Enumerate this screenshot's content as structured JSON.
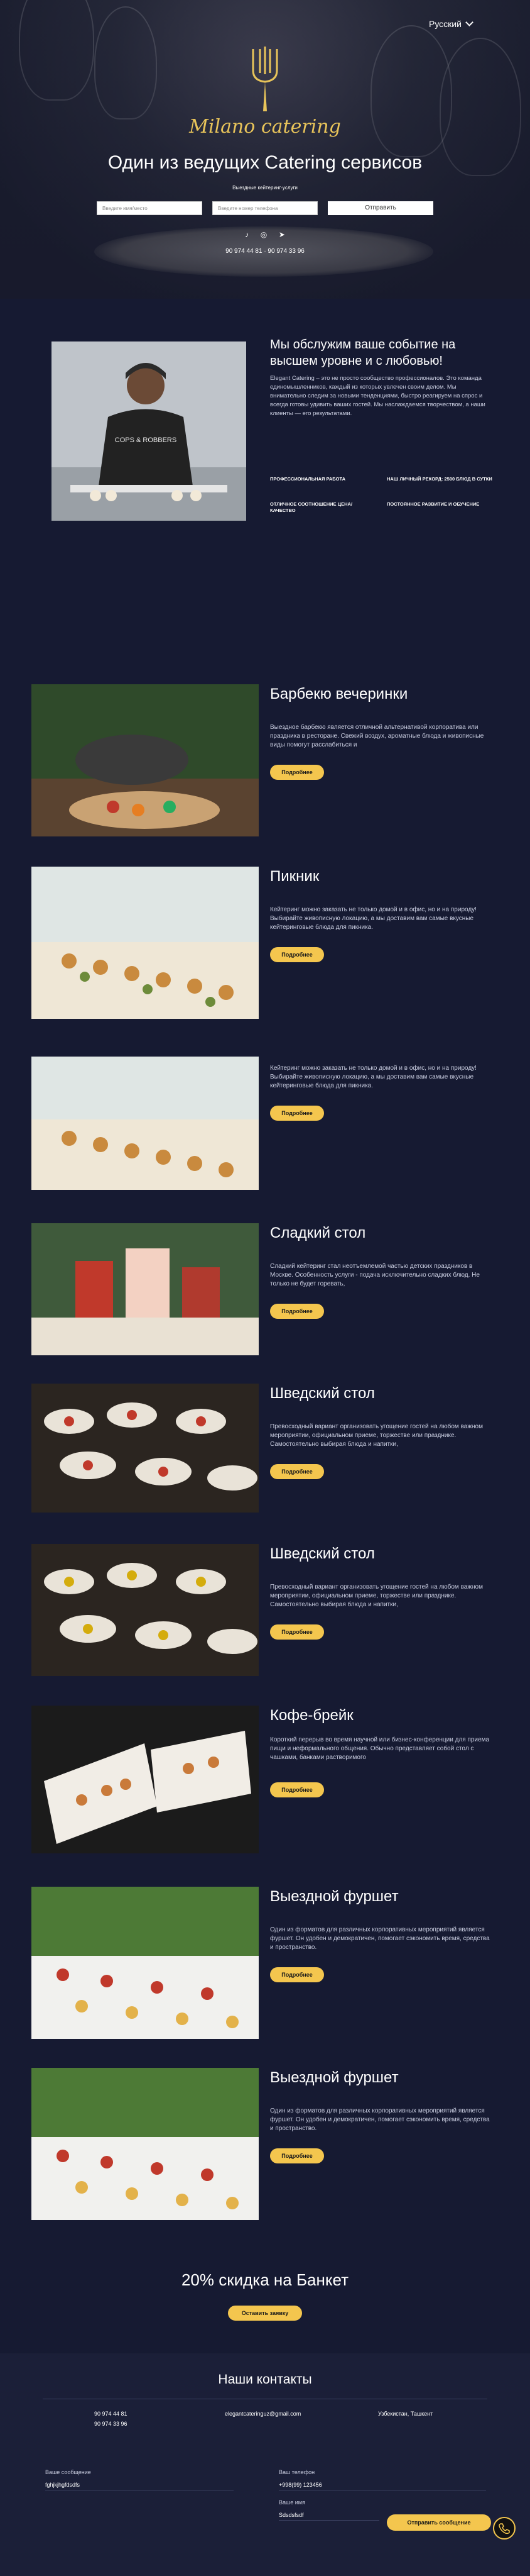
{
  "header": {
    "language": "Русский",
    "brand": "Milano catering",
    "headline": "Один из ведущих Catering сервисов",
    "subline": "Выездные кейтеринг-услуги",
    "fields": [
      "Введите имя/место",
      "Введите номер телефона",
      ""
    ],
    "send_label": "Отправить",
    "phones": "90 974 44 81  ·  90 974 33 96"
  },
  "about": {
    "title": "Мы обслужим ваше событие на высшем уровне и с любовью!",
    "text": "Elegant Catering – это не просто сообщество профессионалов. Это команда единомышленников, каждый из которых увлечен своим делом. Мы внимательно следим за новыми тенденциями, быстро реагируем на спрос и всегда готовы удивить ваших гостей. Мы наслаждаемся творчеством, а наши клиенты — его результатами.",
    "features": [
      "ПРОФЕССИОНАЛЬНАЯ РАБОТА",
      "НАШ ЛИЧНЫЙ РЕКОРД: 2500 БЛЮД В СУТКИ",
      "ОТЛИЧНОЕ СООТНОШЕНИЕ ЦЕНА/КАЧЕСТВО",
      "ПОСТОЯННОЕ РАЗВИТИЕ И ОБУЧЕНИЕ"
    ]
  },
  "services": [
    {
      "title": "Барбекю вечеринки",
      "desc": "Выездное барбекю является отличной альтернативой корпоратива или праздника в ресторане. Свежий воздух, ароматные блюда и живописные виды помогут расслабиться и",
      "button": "Подробнее"
    },
    {
      "title": "Пикник",
      "desc": "Кейтеринг можно заказать не только домой и в офис, но и на природу! Выбирайте живописную локацию, а мы доставим вам самые вкусные кейтеринговые блюда для пикника.",
      "button": "Подробнее"
    },
    {
      "title": "",
      "desc": "Кейтеринг можно заказать не только домой и в офис, но и на природу! Выбирайте живописную локацию, а мы доставим вам самые вкусные кейтеринговые блюда для пикника.",
      "button": "Подробнее"
    },
    {
      "title": "Сладкий стол",
      "desc": "Сладкий кейтеринг стал неотъемлемой частью детских праздников в Москве. Особенность услуги - подача исключительно сладких блюд. Не только не будет горевать,",
      "button": "Подробнее"
    },
    {
      "title": "Шведский стол",
      "desc": "Превосходный вариант организовать угощение гостей на любом важном мероприятии, официальном приеме, торжестве или празднике. Самостоятельно выбирая блюда и напитки,",
      "button": "Подробнее"
    },
    {
      "title": "Шведский стол",
      "desc": "Превосходный вариант организовать угощение гостей на любом важном мероприятии, официальном приеме, торжестве или празднике. Самостоятельно выбирая блюда и напитки,",
      "button": "Подробнее"
    },
    {
      "title": "Кофе-брейк",
      "desc": "Короткий перерыв во время научной или бизнес-конференции для приема пищи и неформального общения. Обычно представляет собой стол с чашками, банками растворимого",
      "button": "Подробнее"
    },
    {
      "title": "Выездной фуршет",
      "desc": "Один из форматов для различных корпоративных мероприятий является фуршет. Он удобен и демократичен, помогает сэкономить время, средства и пространство.",
      "button": "Подробнее"
    },
    {
      "title": "Выездной фуршет",
      "desc": "Один из форматов для различных корпоративных мероприятий является фуршет. Он удобен и демократичен, помогает сэкономить время, средства и пространство.",
      "button": "Подробнее"
    }
  ],
  "discount": {
    "title": "20% скидка на Банкет",
    "button": "Оставить заявку"
  },
  "contacts": {
    "title": "Наши контакты",
    "phone1": "90 974 44 81",
    "phone2": "90 974 33 96",
    "email": "elegantcateringuz@gmail.com",
    "address": "Узбекистан, Ташкент",
    "message_label": "Ваше сообщение",
    "message_value": "fghjkjhgfdsdfs",
    "phone_label": "Ваш телефон",
    "phone_value": "+998(99) 123456",
    "name_label": "Ваше имя",
    "name_value": "Sdsdsfsdf",
    "send_label": "Отправить сообщение"
  }
}
